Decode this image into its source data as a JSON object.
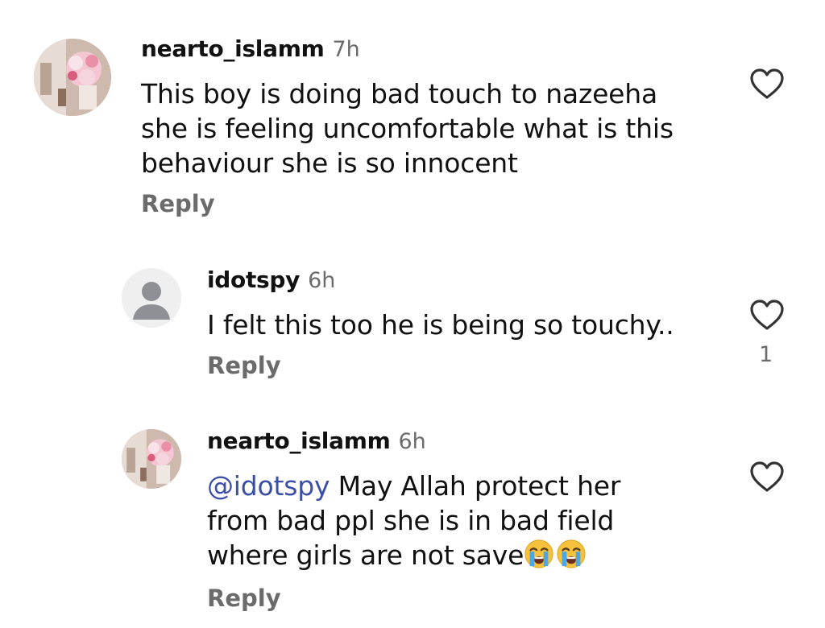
{
  "comments": [
    {
      "username": "nearto_islamm",
      "time": "7h",
      "avatar": "profile-photo-flowers",
      "lines": [
        "This boy is doing bad touch to nazeeha",
        "she is feeling uncomfortable what is this",
        "behaviour she is so innocent"
      ],
      "reply_label": "Reply",
      "likes": ""
    },
    {
      "username": "idotspy",
      "time": "6h",
      "avatar": "default-avatar",
      "lines": [
        "I felt this too he is being so touchy.."
      ],
      "reply_label": "Reply",
      "likes": "1"
    },
    {
      "username": "nearto_islamm",
      "time": "6h",
      "avatar": "profile-photo-flowers",
      "mention": "@idotspy",
      "lines": [
        " May Allah protect her",
        "from bad ppl she is in bad field",
        "where girls are not save"
      ],
      "emojis": [
        "loudly-crying-face",
        "loudly-crying-face"
      ],
      "reply_label": "Reply",
      "likes": ""
    }
  ],
  "colors": {
    "text": "#111111",
    "secondary": "#6b6b6b",
    "mention": "#3b4fa8",
    "background": "#ffffff"
  }
}
